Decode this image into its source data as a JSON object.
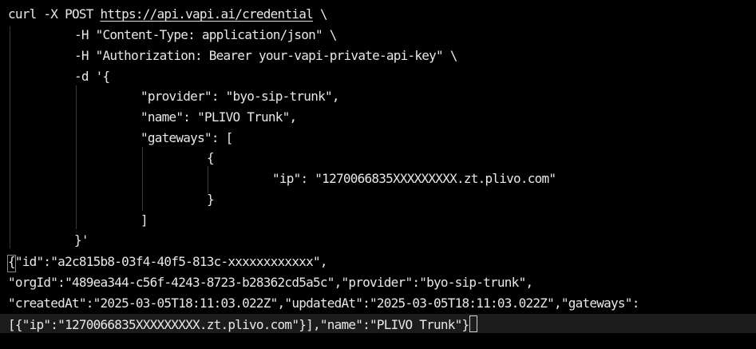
{
  "command": {
    "line1_prefix": "curl -X POST ",
    "line1_url": "https://api.vapi.ai/credential",
    "line1_suffix": " \\",
    "line2": "-H \"Content-Type: application/json\" \\",
    "line3": "-H \"Authorization: Bearer your-vapi-private-api-key\" \\",
    "line4": "-d '{",
    "line5": "\"provider\": \"byo-sip-trunk\",",
    "line6": "\"name\": \"PLIVO Trunk\",",
    "line7": "\"gateways\": [",
    "line8": "{",
    "line9": "\"ip\": \"1270066835XXXXXXXXX.zt.plivo.com\"",
    "line10": "}",
    "line11": "]",
    "line12": "}'"
  },
  "response": {
    "line1": "{\"id\":\"a2c815b8-03f4-40f5-813c-xxxxxxxxxxxx\",",
    "line2": "\"orgId\":\"489ea344-c56f-4243-8723-b28362cd5a5c\",\"provider\":\"byo-sip-trunk\",",
    "line3": "\"createdAt\":\"2025-03-05T18:11:03.022Z\",\"updatedAt\":\"2025-03-05T18:11:03.022Z\",\"gateways\":",
    "line4": "[{\"ip\":\"1270066835XXXXXXXXX.zt.plivo.com\"}],\"name\":\"PLIVO Trunk\"}"
  },
  "colors": {
    "background": "#000000",
    "text": "#e8e8e8",
    "indent_guide": "#3a3a3a"
  }
}
